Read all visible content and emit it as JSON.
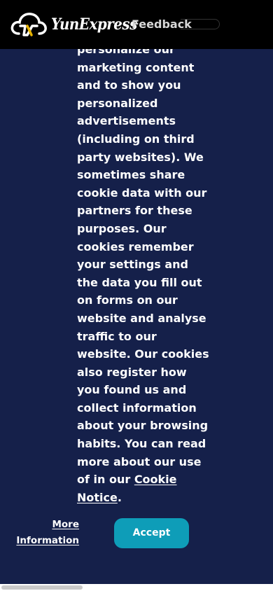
{
  "header": {
    "logo_text": "YunExpress",
    "feedback_label": "Feedback"
  },
  "cookie_banner": {
    "text_lines": [
      "personalize our",
      "marketing content",
      "and to show you",
      "personalized",
      "advertisements",
      "(including on third",
      "party websites). We",
      "sometimes share",
      "cookie data with our",
      "partners for these",
      "purposes. Our",
      "cookies remember",
      "your settings and",
      "the data you fill out",
      "on forms on our",
      "website and analyse",
      "traffic to our",
      "website. Our cookies",
      "also register how",
      "you found us and",
      "collect information",
      "about your browsing",
      "habits. You can read",
      "more about our use"
    ],
    "last_line_prefix": "of in our ",
    "cookie_notice_word1": "Cookie",
    "cookie_notice_word2": "Notice",
    "last_line_suffix": ".",
    "more_info_line1": "More",
    "more_info_line2": "Information",
    "accept_label": "Accept"
  },
  "colors": {
    "header_bg": "#000000",
    "banner_bg": "#15204a",
    "accept_bg": "#0e9db8",
    "text": "#ffffff"
  }
}
